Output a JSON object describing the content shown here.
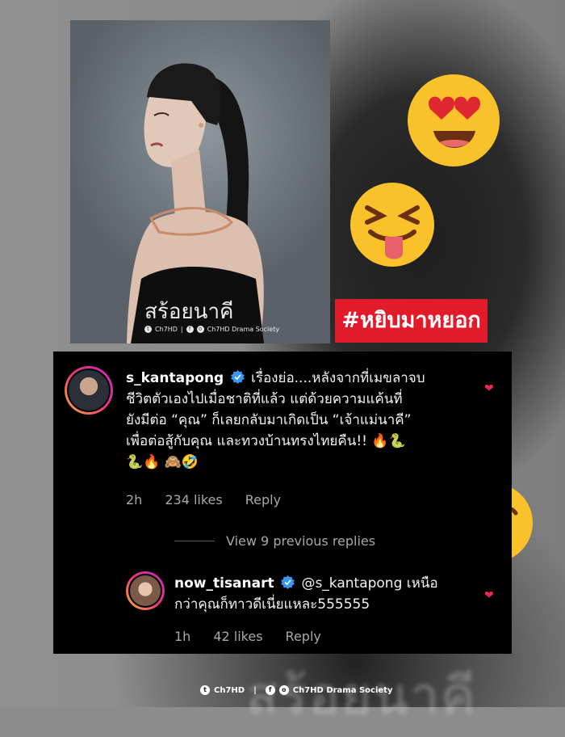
{
  "poster": {
    "title": "สร้อยนาคี",
    "credit_ch": "Ch7HD",
    "credit_society": "Ch7HD Drama Society"
  },
  "hashtag": "#หยิบมาหยอก",
  "background_text": "สร้อยนาคี",
  "comment1": {
    "username": "s_kantapong",
    "line1": "เรื่องย่อ....หลังจากที่เมขลาจบ",
    "line2": "ชีวิตตัวเองไปเมื่อชาติที่แล้ว แต่ด้วยความแค้นที่",
    "line3": "ยังมีต่อ “คุณ” ก็เลยกลับมาเกิดเป็น “เจ้าแม่นาคี”",
    "line4": "เพื่อต่อสู้กับคุณ และทวงบ้านทรงไทยคืน!! 🔥🐍",
    "line5": "🐍🔥 🙈🤣",
    "time": "2h",
    "likes": "234 likes",
    "reply": "Reply"
  },
  "view_replies": "View 9 previous replies",
  "comment2": {
    "username": "now_tisanart",
    "line1": "@s_kantapong เหนือ",
    "line2": "กว่าคุณก็ทาวดีเนี่ยแหละ555555",
    "time": "1h",
    "likes": "42 likes",
    "reply": "Reply"
  },
  "footer": {
    "ch": "Ch7HD",
    "society": "Ch7HD Drama Society"
  },
  "icons": {
    "verified": "verified-badge-icon",
    "heart": "heart-icon",
    "emoji1": "heart-eyes-emoji",
    "emoji2": "tongue-out-emoji",
    "emoji3": "kissing-heart-emoji"
  },
  "colors": {
    "hashtag_bg": "#e21b2b",
    "panel_bg": "#000000",
    "heart": "#e52a4d",
    "verified": "#3897f0"
  }
}
